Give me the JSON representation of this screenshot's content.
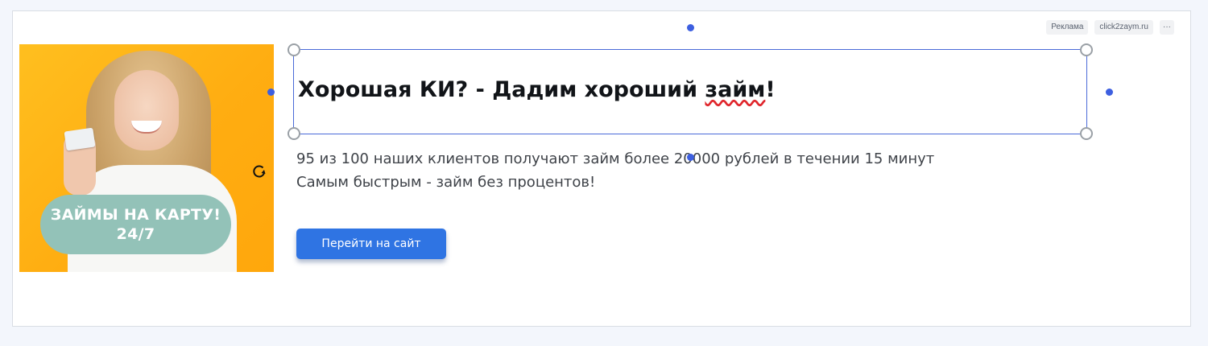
{
  "ad": {
    "label_ad": "Реклама",
    "label_domain": "click2zaym.ru",
    "label_more": "···",
    "image": {
      "badge_line1": "ЗАЙМЫ НА КАРТУ!",
      "badge_line2": "24/7"
    },
    "headline_before": "Хорошая КИ? - Дадим хороший ",
    "headline_misspelled": "займ",
    "headline_after": "!",
    "description_line1": "95 из 100 наших клиентов получают займ более 20000 рублей в течении 15 минут",
    "description_line2": "Самым быстрым - займ без процентов!",
    "cta_label": "Перейти на сайт"
  },
  "colors": {
    "accent": "#2f74e3",
    "selection": "#4a6ad8",
    "image_background": "#ffb116",
    "badge": "#93c2b8",
    "spellcheck": "#e0262c"
  },
  "icons": [
    "rotate-icon",
    "resize-handle-icon",
    "anchor-dot-icon",
    "more-icon"
  ]
}
